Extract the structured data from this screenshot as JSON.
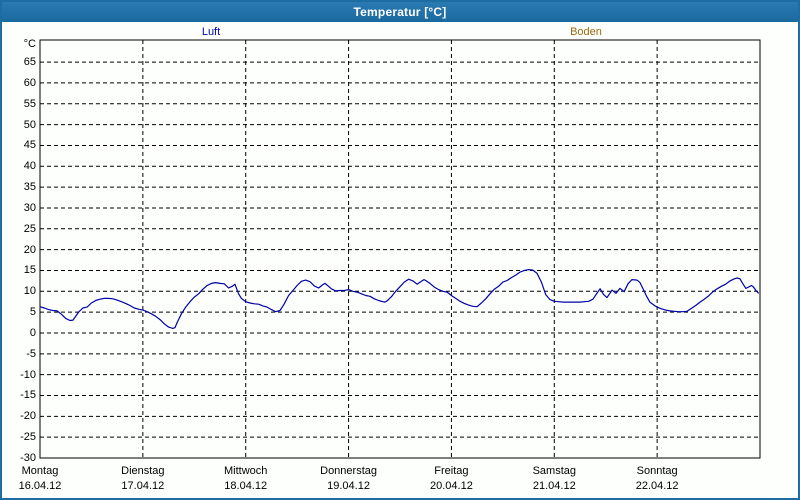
{
  "window": {
    "title": "Temperatur [°C]"
  },
  "colors": {
    "titlebar_bg_top": "#2b7ab2",
    "titlebar_bg_bottom": "#1a699f",
    "titlebar_text": "#ffffff",
    "window_border": "#1e6da2",
    "background": "#fdfffd",
    "grid": "#000000",
    "luft_series": "#0000a8",
    "boden_series": "#9c6a10"
  },
  "chart_data": {
    "type": "line",
    "title": "Temperatur [°C]",
    "y_unit": "°C",
    "ylabel": "Temperatur",
    "y_ticks": [
      65,
      60,
      55,
      50,
      45,
      40,
      35,
      30,
      25,
      20,
      15,
      10,
      5,
      0,
      -5,
      -10,
      -15,
      -20,
      -25,
      -30
    ],
    "y_axis_range": [
      -30,
      70
    ],
    "grid": "dashed",
    "legend_position": "top",
    "x_range_hours": [
      0,
      168
    ],
    "x_categories": [
      {
        "name": "Montag",
        "date": "16.04.12"
      },
      {
        "name": "Dienstag",
        "date": "17.04.12"
      },
      {
        "name": "Mittwoch",
        "date": "18.04.12"
      },
      {
        "name": "Donnerstag",
        "date": "19.04.12"
      },
      {
        "name": "Freitag",
        "date": "20.04.12"
      },
      {
        "name": "Samstag",
        "date": "21.04.12"
      },
      {
        "name": "Sonntag",
        "date": "22.04.12"
      }
    ],
    "series": [
      {
        "name": "Luft",
        "color": "#0000a8",
        "visible": true,
        "points": [
          [
            0,
            6.3
          ],
          [
            1,
            6.0
          ],
          [
            2,
            5.6
          ],
          [
            3,
            5.4
          ],
          [
            4,
            5.3
          ],
          [
            5,
            4.5
          ],
          [
            6,
            3.5
          ],
          [
            7,
            3.0
          ],
          [
            7.7,
            3.1
          ],
          [
            9,
            5.0
          ],
          [
            10,
            6.0
          ],
          [
            11,
            6.2
          ],
          [
            12,
            7.2
          ],
          [
            13,
            7.8
          ],
          [
            14,
            8.1
          ],
          [
            15,
            8.3
          ],
          [
            16,
            8.3
          ],
          [
            17,
            8.2
          ],
          [
            18,
            7.9
          ],
          [
            19,
            7.5
          ],
          [
            20,
            7.1
          ],
          [
            21,
            6.6
          ],
          [
            22,
            6.0
          ],
          [
            23,
            5.7
          ],
          [
            24,
            5.5
          ],
          [
            25,
            5.1
          ],
          [
            26,
            4.6
          ],
          [
            27,
            4.0
          ],
          [
            28,
            3.2
          ],
          [
            29,
            2.2
          ],
          [
            30,
            1.4
          ],
          [
            31,
            1.1
          ],
          [
            31.5,
            1.3
          ],
          [
            32,
            2.5
          ],
          [
            33,
            4.6
          ],
          [
            34,
            6.2
          ],
          [
            35,
            7.5
          ],
          [
            36,
            8.6
          ],
          [
            37,
            9.4
          ],
          [
            38,
            10.5
          ],
          [
            39,
            11.4
          ],
          [
            40,
            11.9
          ],
          [
            41,
            12.1
          ],
          [
            42,
            11.9
          ],
          [
            43,
            11.8
          ],
          [
            44,
            10.8
          ],
          [
            45,
            11.3
          ],
          [
            45.5,
            11.7
          ],
          [
            46.3,
            9.5
          ],
          [
            47,
            8.3
          ],
          [
            48,
            7.5
          ],
          [
            49,
            7.2
          ],
          [
            50,
            7.0
          ],
          [
            51,
            6.9
          ],
          [
            52,
            6.5
          ],
          [
            53,
            6.2
          ],
          [
            54,
            5.6
          ],
          [
            55,
            5.1
          ],
          [
            56,
            5.4
          ],
          [
            57,
            7.0
          ],
          [
            58,
            9.0
          ],
          [
            59,
            10.2
          ],
          [
            60,
            11.4
          ],
          [
            61,
            12.4
          ],
          [
            62,
            12.7
          ],
          [
            63,
            12.3
          ],
          [
            64,
            11.3
          ],
          [
            65,
            10.8
          ],
          [
            66,
            11.6
          ],
          [
            66.5,
            11.9
          ],
          [
            67,
            11.5
          ],
          [
            68,
            10.6
          ],
          [
            69,
            10.1
          ],
          [
            70,
            10.2
          ],
          [
            71,
            10.2
          ],
          [
            72,
            10.4
          ],
          [
            73,
            10.0
          ],
          [
            74,
            9.8
          ],
          [
            75,
            9.4
          ],
          [
            76,
            9.0
          ],
          [
            77,
            8.8
          ],
          [
            78,
            8.2
          ],
          [
            79,
            7.8
          ],
          [
            80,
            7.5
          ],
          [
            80.5,
            7.4
          ],
          [
            81,
            7.7
          ],
          [
            82,
            8.7
          ],
          [
            83,
            10.0
          ],
          [
            84,
            11.1
          ],
          [
            85,
            12.2
          ],
          [
            86,
            12.9
          ],
          [
            87,
            12.5
          ],
          [
            88,
            11.7
          ],
          [
            89,
            12.4
          ],
          [
            89.6,
            12.8
          ],
          [
            90,
            12.6
          ],
          [
            91,
            11.9
          ],
          [
            92,
            11.0
          ],
          [
            93,
            10.4
          ],
          [
            94,
            10.0
          ],
          [
            95,
            9.8
          ],
          [
            96,
            9.0
          ],
          [
            97,
            8.3
          ],
          [
            98,
            7.6
          ],
          [
            99,
            7.1
          ],
          [
            100,
            6.7
          ],
          [
            101,
            6.4
          ],
          [
            102,
            6.3
          ],
          [
            103,
            7.2
          ],
          [
            104,
            8.2
          ],
          [
            105,
            9.4
          ],
          [
            106,
            10.5
          ],
          [
            107,
            11.2
          ],
          [
            108,
            12.2
          ],
          [
            109,
            12.6
          ],
          [
            110,
            13.3
          ],
          [
            111,
            13.9
          ],
          [
            112,
            14.6
          ],
          [
            113,
            15.0
          ],
          [
            114,
            15.2
          ],
          [
            115,
            15.1
          ],
          [
            116,
            14.3
          ],
          [
            117,
            12.2
          ],
          [
            118,
            9.2
          ],
          [
            119,
            8.0
          ],
          [
            120,
            7.6
          ],
          [
            121,
            7.5
          ],
          [
            122,
            7.4
          ],
          [
            124,
            7.4
          ],
          [
            126,
            7.4
          ],
          [
            127,
            7.5
          ],
          [
            128,
            7.6
          ],
          [
            129,
            8.1
          ],
          [
            130,
            9.6
          ],
          [
            130.7,
            10.6
          ],
          [
            131.5,
            9.2
          ],
          [
            132.3,
            8.5
          ],
          [
            133.5,
            10.3
          ],
          [
            134.4,
            9.5
          ],
          [
            135.3,
            10.7
          ],
          [
            136.3,
            9.9
          ],
          [
            137.2,
            11.8
          ],
          [
            138.1,
            12.8
          ],
          [
            139.3,
            12.7
          ],
          [
            140,
            12.1
          ],
          [
            140.7,
            10.6
          ],
          [
            141.5,
            8.9
          ],
          [
            142.3,
            7.4
          ],
          [
            143.5,
            6.5
          ],
          [
            144,
            6.2
          ],
          [
            145,
            5.8
          ],
          [
            146,
            5.5
          ],
          [
            147,
            5.3
          ],
          [
            148,
            5.2
          ],
          [
            149,
            5.1
          ],
          [
            150,
            5.1
          ],
          [
            151,
            5.2
          ],
          [
            152,
            5.9
          ],
          [
            153,
            6.6
          ],
          [
            154,
            7.4
          ],
          [
            155,
            8.1
          ],
          [
            156,
            8.9
          ],
          [
            157,
            9.9
          ],
          [
            158,
            10.6
          ],
          [
            159,
            11.2
          ],
          [
            160,
            11.7
          ],
          [
            161,
            12.5
          ],
          [
            162,
            13.0
          ],
          [
            162.7,
            13.2
          ],
          [
            163.3,
            13.0
          ],
          [
            164,
            11.8
          ],
          [
            164.7,
            10.7
          ],
          [
            165.3,
            11.0
          ],
          [
            166,
            11.4
          ],
          [
            166.5,
            11.0
          ],
          [
            167,
            10.3
          ],
          [
            167.7,
            9.5
          ]
        ]
      },
      {
        "name": "Boden",
        "color": "#9c6a10",
        "visible": false,
        "points": []
      }
    ]
  }
}
